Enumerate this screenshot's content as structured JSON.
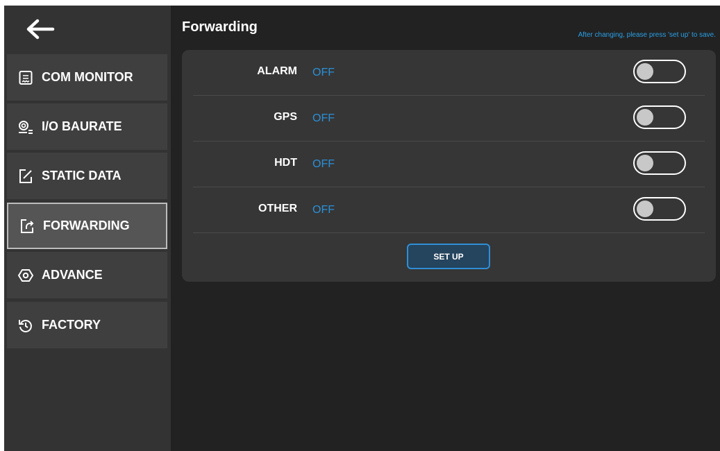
{
  "header": {
    "title": "Forwarding",
    "hint": "After changing, please press 'set up' to save."
  },
  "sidebar": {
    "back_icon": "arrow-left-icon",
    "items": [
      {
        "label": "COM MONITOR",
        "icon": "receipt-icon",
        "active": false
      },
      {
        "label": "I/O BAURATE",
        "icon": "baudrate-icon",
        "active": false
      },
      {
        "label": "STATIC DATA",
        "icon": "edit-icon",
        "active": false
      },
      {
        "label": "FORWARDING",
        "icon": "share-icon",
        "active": true
      },
      {
        "label": "ADVANCE",
        "icon": "hexagon-settings-icon",
        "active": false
      },
      {
        "label": "FACTORY",
        "icon": "history-icon",
        "active": false
      }
    ]
  },
  "forwarding": {
    "rows": [
      {
        "label": "ALARM",
        "status": "OFF",
        "enabled": false
      },
      {
        "label": "GPS",
        "status": "OFF",
        "enabled": false
      },
      {
        "label": "HDT",
        "status": "OFF",
        "enabled": false
      },
      {
        "label": "OTHER",
        "status": "OFF",
        "enabled": false
      }
    ],
    "setup_label": "SET UP"
  },
  "colors": {
    "background": "#222222",
    "sidebar": "#333333",
    "panel": "#363636",
    "accent": "#2a90d8"
  }
}
